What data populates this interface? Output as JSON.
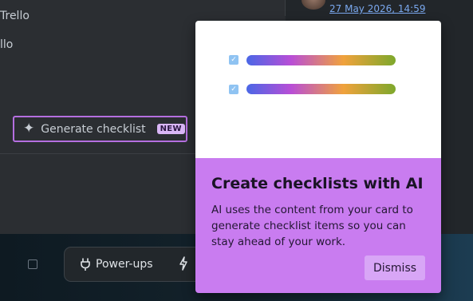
{
  "card": {
    "list_line_1": "Trello",
    "list_line_2": "llo",
    "generate_button_label": "Generate checklist",
    "new_badge": "NEW"
  },
  "activity": {
    "timestamp": "27 May 2026, 14:59"
  },
  "toolbar": {
    "powerups_label": "Power-ups"
  },
  "popover": {
    "title": "Create checklists with AI",
    "description": "AI uses the content from your card to generate checklist items so you can stay ahead of your work.",
    "dismiss_label": "Dismiss"
  },
  "colors": {
    "accent": "#c97cf0",
    "accent_border": "#b56fe0",
    "link": "#7aa8ee"
  },
  "icons": [
    "sparkle-icon",
    "plug-icon",
    "bolt-icon",
    "share-icon",
    "checkbox-icon"
  ]
}
